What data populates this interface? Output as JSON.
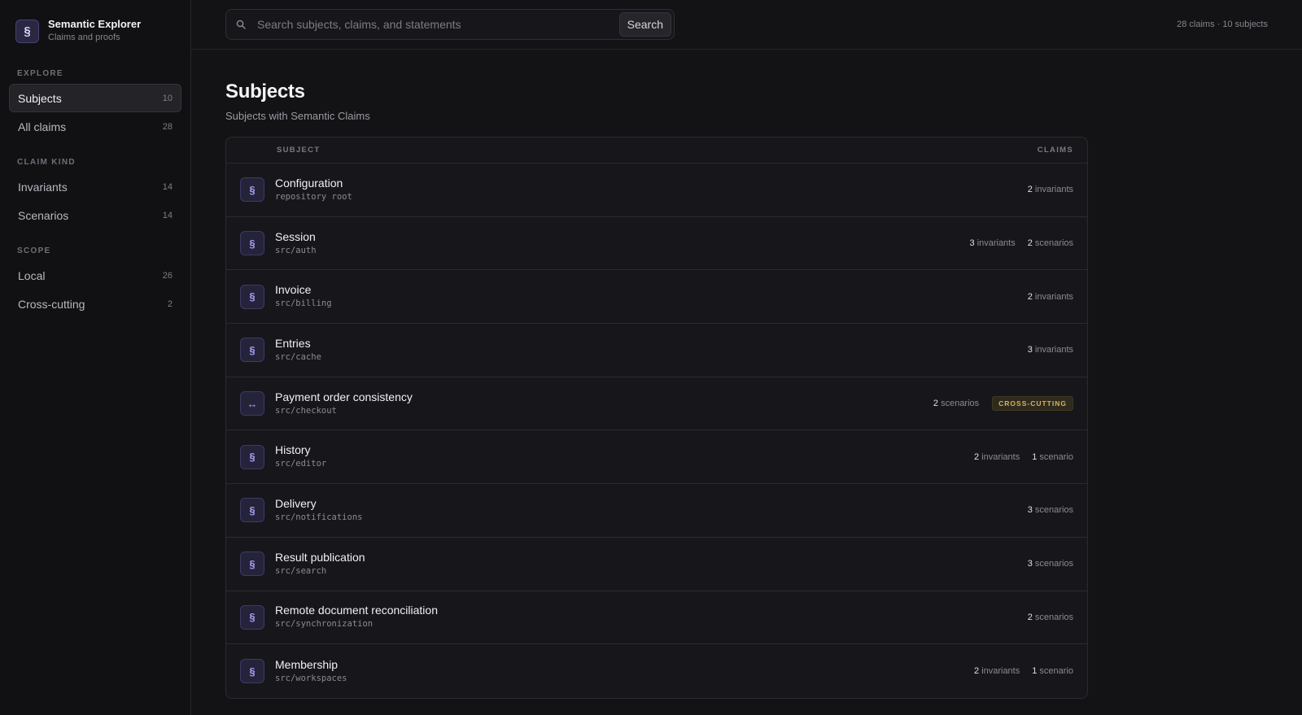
{
  "brand": {
    "title": "Semantic Explorer",
    "subtitle": "Claims and proofs",
    "logo": "§"
  },
  "nav": {
    "explore": {
      "label": "Explore",
      "items": [
        {
          "label": "Subjects",
          "count": "10"
        },
        {
          "label": "All claims",
          "count": "28"
        }
      ]
    },
    "claim_kind": {
      "label": "Claim kind",
      "items": [
        {
          "label": "Invariants",
          "count": "14"
        },
        {
          "label": "Scenarios",
          "count": "14"
        }
      ]
    },
    "scope": {
      "label": "Scope",
      "items": [
        {
          "label": "Local",
          "count": "26"
        },
        {
          "label": "Cross-cutting",
          "count": "2"
        }
      ]
    }
  },
  "search": {
    "placeholder": "Search subjects, claims, and statements",
    "button": "Search",
    "icon": "search-icon"
  },
  "stats": "28 claims · 10 subjects",
  "page": {
    "title": "Subjects",
    "subtitle": "Subjects with Semantic Claims"
  },
  "table": {
    "col_subject": "SUBJECT",
    "col_claims": "CLAIMS",
    "rows": [
      {
        "icon": "§",
        "name": "Configuration",
        "path": "repository root",
        "claims": [
          {
            "num": "2",
            "label": "invariants"
          }
        ]
      },
      {
        "icon": "§",
        "name": "Session",
        "path": "src/auth",
        "claims": [
          {
            "num": "3",
            "label": "invariants"
          },
          {
            "num": "2",
            "label": "scenarios"
          }
        ]
      },
      {
        "icon": "§",
        "name": "Invoice",
        "path": "src/billing",
        "claims": [
          {
            "num": "2",
            "label": "invariants"
          }
        ]
      },
      {
        "icon": "§",
        "name": "Entries",
        "path": "src/cache",
        "claims": [
          {
            "num": "3",
            "label": "invariants"
          }
        ]
      },
      {
        "icon": "↔",
        "name": "Payment order consistency",
        "path": "src/checkout",
        "claims": [
          {
            "num": "2",
            "label": "scenarios"
          }
        ],
        "badge": "CROSS-CUTTING"
      },
      {
        "icon": "§",
        "name": "History",
        "path": "src/editor",
        "claims": [
          {
            "num": "2",
            "label": "invariants"
          },
          {
            "num": "1",
            "label": "scenario"
          }
        ]
      },
      {
        "icon": "§",
        "name": "Delivery",
        "path": "src/notifications",
        "claims": [
          {
            "num": "3",
            "label": "scenarios"
          }
        ]
      },
      {
        "icon": "§",
        "name": "Result publication",
        "path": "src/search",
        "claims": [
          {
            "num": "3",
            "label": "scenarios"
          }
        ]
      },
      {
        "icon": "§",
        "name": "Remote document reconciliation",
        "path": "src/synchronization",
        "claims": [
          {
            "num": "2",
            "label": "scenarios"
          }
        ]
      },
      {
        "icon": "§",
        "name": "Membership",
        "path": "src/workspaces",
        "claims": [
          {
            "num": "2",
            "label": "invariants"
          },
          {
            "num": "1",
            "label": "scenario"
          }
        ]
      }
    ]
  }
}
